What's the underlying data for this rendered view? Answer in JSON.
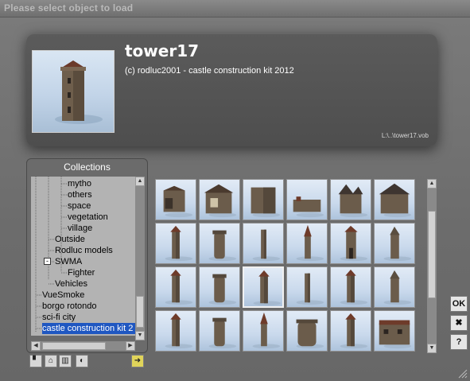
{
  "window": {
    "title": "Please select object to load"
  },
  "preview": {
    "name": "tower17",
    "copyright": "(c) rodluc2001 - castle construction kit 2012",
    "path": "L:\\..\\tower17.vob"
  },
  "collections": {
    "header": "Collections",
    "items": [
      {
        "label": "mytho",
        "indent": 3
      },
      {
        "label": "others",
        "indent": 3
      },
      {
        "label": "space",
        "indent": 3
      },
      {
        "label": "vegetation",
        "indent": 3
      },
      {
        "label": "village",
        "indent": 3
      },
      {
        "label": "Outside",
        "indent": 2
      },
      {
        "label": "Rodluc models",
        "indent": 2
      },
      {
        "label": "SWMA",
        "indent": 2,
        "expander": "-"
      },
      {
        "label": "Fighter",
        "indent": 3
      },
      {
        "label": "Vehicles",
        "indent": 2
      },
      {
        "label": "VueSmoke",
        "indent": 1
      },
      {
        "label": "borgo rotondo",
        "indent": 1
      },
      {
        "label": "sci-fi city",
        "indent": 1
      },
      {
        "label": "castle construction kit 2",
        "indent": 1,
        "selected": true
      }
    ],
    "toolbar": [
      "new-collection-icon",
      "lock-icon",
      "trash-icon",
      "info-icon",
      "arrow-right-icon"
    ]
  },
  "grid": {
    "selected_index": 14,
    "thumbnails": [
      "ruin-wall",
      "house-open",
      "square-keep",
      "low-wall",
      "gothic-chapel",
      "gabled-hall",
      "tall-tower",
      "round-tower",
      "slim-tower",
      "spire-tower",
      "gate-tower",
      "pointed-tower",
      "tower-a",
      "tower-b",
      "tower17",
      "tower-c",
      "tower-d",
      "tower-e",
      "tower-f",
      "tower-g",
      "tower-h",
      "round-keep",
      "tower-i",
      "manor"
    ]
  },
  "side_buttons": {
    "ok": "OK",
    "cancel": "✖",
    "help": "?"
  },
  "colors": {
    "selection": "#1f57c1",
    "panel": "#6b6b6b"
  }
}
